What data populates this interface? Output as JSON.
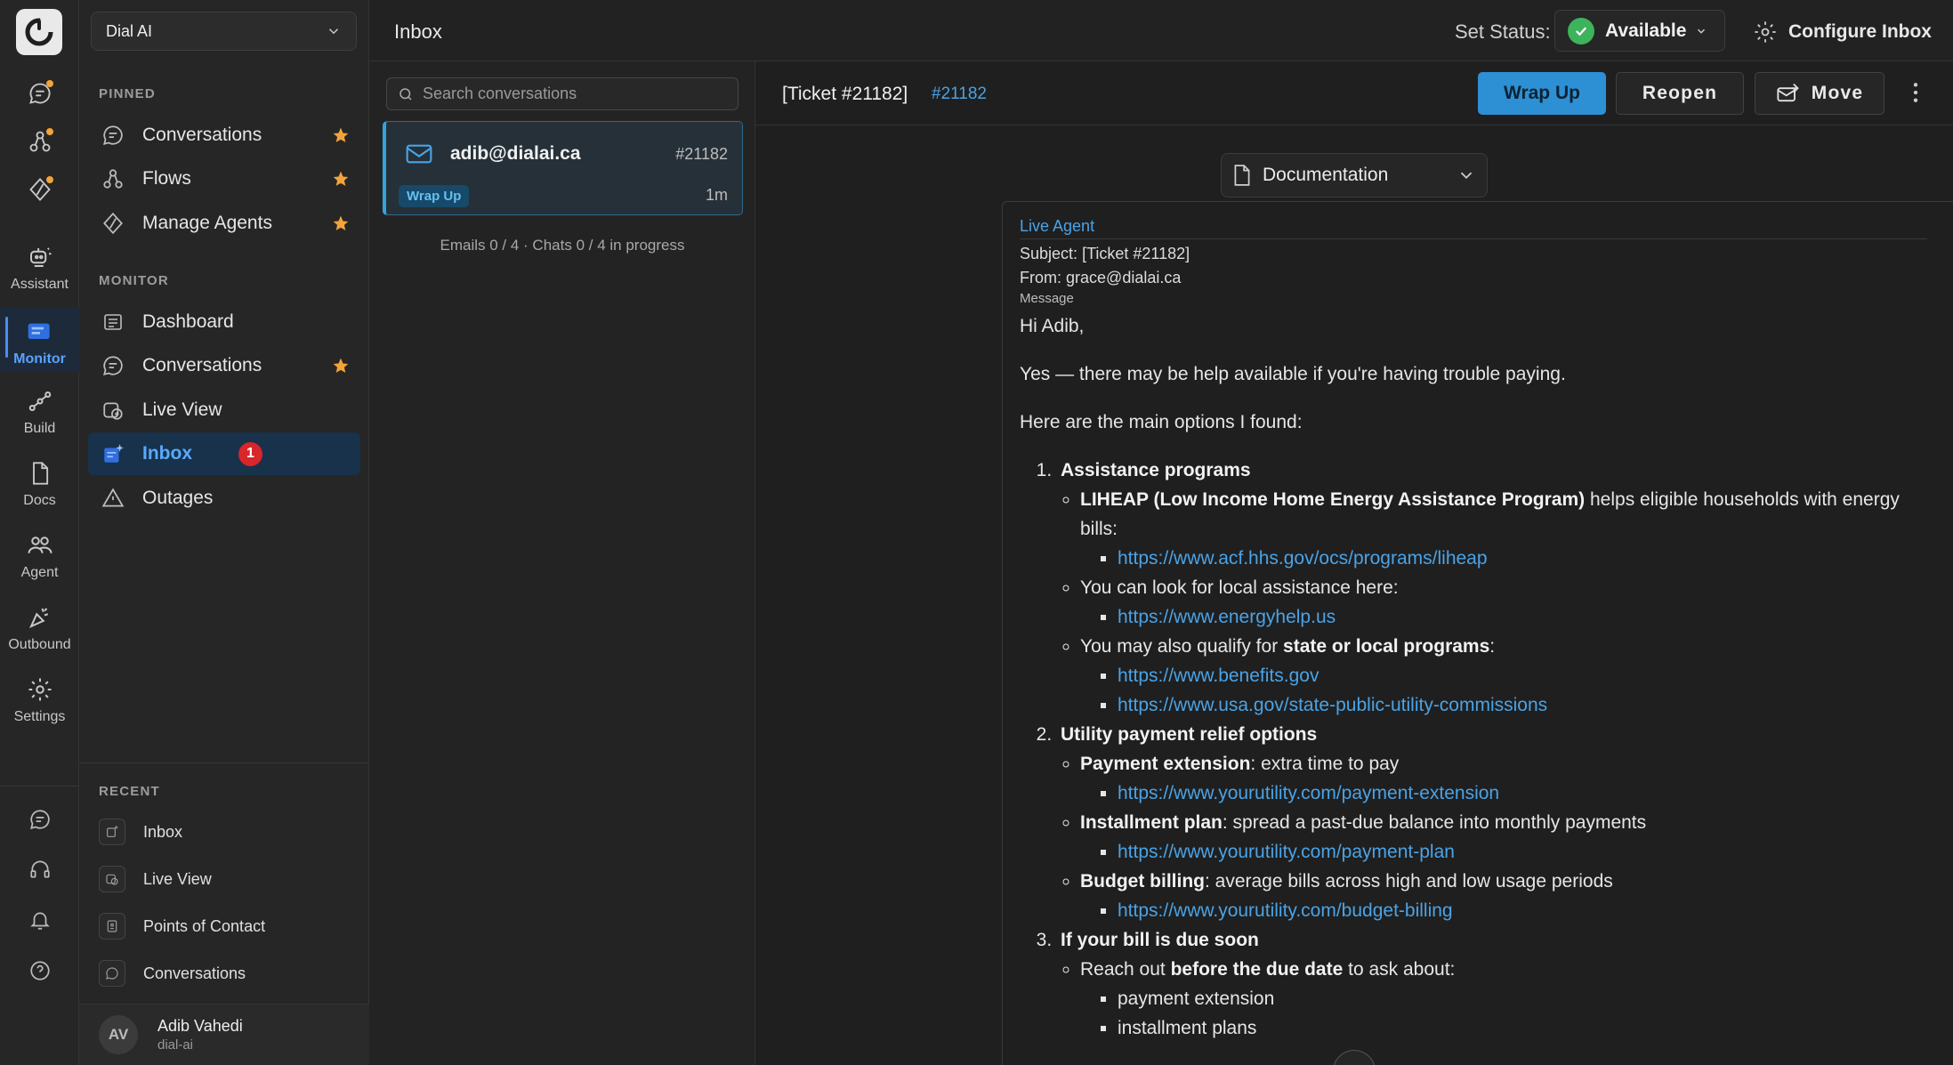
{
  "rail": {
    "items": [
      {
        "label": "",
        "icon": "chat-icon",
        "dot": true
      },
      {
        "label": "",
        "icon": "flows-icon",
        "dot": true
      },
      {
        "label": "",
        "icon": "agents-icon",
        "dot": true
      },
      {
        "label": "Assistant",
        "icon": "assistant-icon"
      },
      {
        "label": "Monitor",
        "icon": "monitor-icon",
        "active": true
      },
      {
        "label": "Build",
        "icon": "build-icon"
      },
      {
        "label": "Docs",
        "icon": "docs-icon"
      },
      {
        "label": "Agent",
        "icon": "agent-icon"
      },
      {
        "label": "Outbound",
        "icon": "outbound-icon"
      },
      {
        "label": "Settings",
        "icon": "settings-icon"
      }
    ]
  },
  "nav": {
    "workspace": "Dial AI",
    "pinned_title": "PINNED",
    "pinned": [
      {
        "label": "Conversations",
        "starred": true
      },
      {
        "label": "Flows",
        "starred": true
      },
      {
        "label": "Manage Agents",
        "starred": true
      }
    ],
    "monitor_title": "MONITOR",
    "monitor": [
      {
        "label": "Dashboard"
      },
      {
        "label": "Conversations",
        "starred": true
      },
      {
        "label": "Live View"
      },
      {
        "label": "Inbox",
        "active": true,
        "badge": "1"
      },
      {
        "label": "Outages"
      }
    ],
    "recent_title": "RECENT",
    "recent": [
      {
        "label": "Inbox"
      },
      {
        "label": "Live View"
      },
      {
        "label": "Points of Contact"
      },
      {
        "label": "Conversations"
      }
    ],
    "user": {
      "initials": "AV",
      "name": "Adib Vahedi",
      "handle": "dial-ai"
    }
  },
  "header": {
    "title": "Inbox",
    "status_label": "Set Status:",
    "status_value": "Available",
    "configure": "Configure Inbox"
  },
  "list": {
    "search_placeholder": "Search conversations",
    "items": [
      {
        "from": "adib@dialai.ca",
        "ticket": "#21182",
        "tag": "Wrap Up",
        "age": "1m"
      }
    ],
    "progress": "Emails 0 / 4 · Chats 0 / 4 in progress"
  },
  "ticket": {
    "title": "[Ticket #21182]",
    "link": "#21182",
    "actions": {
      "wrap_up": "Wrap Up",
      "reopen": "Reopen",
      "move": "Move"
    },
    "doc_select": "Documentation",
    "message": {
      "sender_label": "Live Agent",
      "subject_label": "Subject:",
      "subject": "[Ticket #21182]",
      "from_label": "From:",
      "from": "grace@dialai.ca",
      "message_label": "Message",
      "greeting": "Hi Adib,",
      "intro": "Yes — there may be help available if you're having trouble paying.",
      "lead": "Here are the main options I found:",
      "s1_title": "Assistance programs",
      "s1_a_bold": "LIHEAP (Low Income Home Energy Assistance Program)",
      "s1_a_rest": " helps eligible households with energy bills:",
      "s1_a_link": "https://www.acf.hhs.gov/ocs/programs/liheap",
      "s1_b": "You can look for local assistance here:",
      "s1_b_link": "https://www.energyhelp.us",
      "s1_c_pre": "You may also qualify for ",
      "s1_c_bold": "state or local programs",
      "s1_c_post": ":",
      "s1_c_link1": "https://www.benefits.gov",
      "s1_c_link2": "https://www.usa.gov/state-public-utility-commissions",
      "s2_title": "Utility payment relief options",
      "s2_a_bold": "Payment extension",
      "s2_a_rest": ": extra time to pay",
      "s2_a_link": "https://www.yourutility.com/payment-extension",
      "s2_b_bold": "Installment plan",
      "s2_b_rest": ": spread a past-due balance into monthly payments",
      "s2_b_link": "https://www.yourutility.com/payment-plan",
      "s2_c_bold": "Budget billing",
      "s2_c_rest": ": average bills across high and low usage periods",
      "s2_c_link": "https://www.yourutility.com/budget-billing",
      "s3_title": "If your bill is due soon",
      "s3_a_pre": "Reach out ",
      "s3_a_bold": "before the due date",
      "s3_a_post": " to ask about:",
      "s3_a_i1": "payment extension",
      "s3_a_i2": "installment plans"
    }
  },
  "colors": {
    "accent": "#2d8fd4",
    "active_nav": "#17324a",
    "badge": "#d8262b",
    "status": "#3db35b",
    "star": "#f2a33a"
  }
}
